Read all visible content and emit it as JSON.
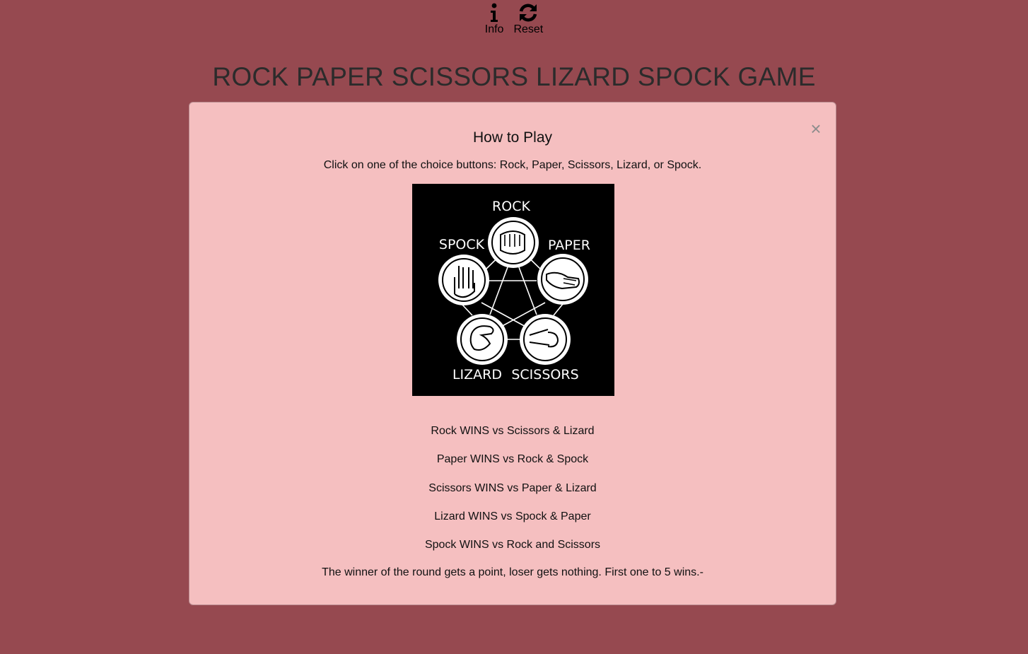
{
  "nav": {
    "info_label": "Info",
    "info_icon": "info-icon",
    "reset_label": "Reset",
    "reset_icon": "refresh-icon"
  },
  "page_title": "ROCK PAPER SCISSORS LIZARD SPOCK GAME",
  "modal": {
    "title": "How to Play",
    "close_symbol": "×",
    "intro": "Click on one of the choice buttons: Rock, Paper, Scissors, Lizard, or Spock.",
    "diagram_labels": {
      "rock": "ROCK",
      "paper": "PAPER",
      "scissors": "SCISSORS",
      "lizard": "LIZARD",
      "spock": "SPOCK"
    },
    "rules": [
      "Rock WINS vs Scissors & Lizard",
      "Paper WINS vs Rock & Spock",
      "Scissors WINS vs Paper & Lizard",
      "Lizard WINS vs Spock & Paper",
      "Spock WINS vs Rock and Scissors"
    ],
    "footer": "The winner of the round gets a point, loser gets nothing. First one to 5 wins.-"
  },
  "colors": {
    "background": "#964950",
    "modal_background": "#f5bfc0"
  }
}
